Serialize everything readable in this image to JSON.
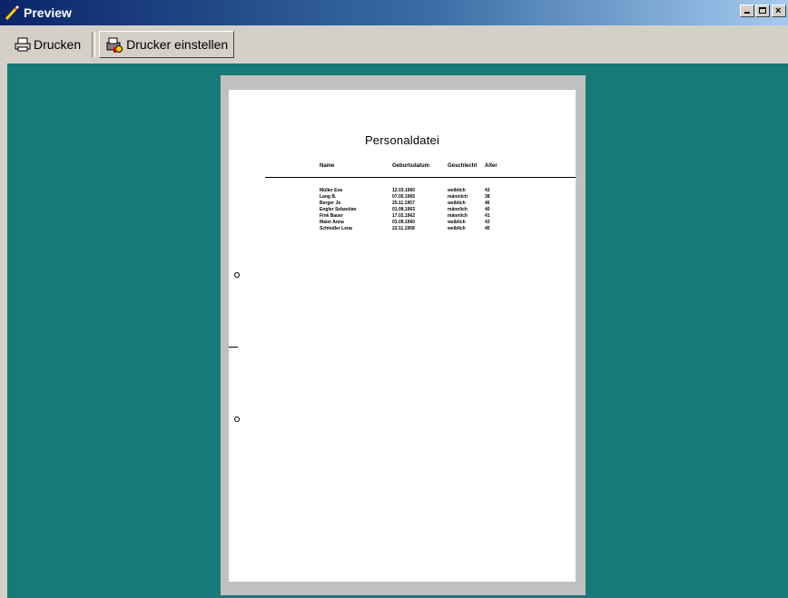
{
  "window": {
    "title": "Preview",
    "app_icon": "wand-icon",
    "controls": [
      "minimize-icon",
      "maximize-icon",
      "close-icon"
    ]
  },
  "toolbar": {
    "print_label": "Drucken",
    "print_icon": "printer-icon",
    "printer_setup_label": "Drucker einstellen",
    "printer_setup_icon": "printer-setup-icon"
  },
  "colors": {
    "workspace": "#177a78",
    "title_bar_start": "#0a246a",
    "title_bar_end": "#a6caf0"
  },
  "document": {
    "title": "Personaldatei",
    "columns": [
      "Name",
      "Geburtsdatum",
      "Geschlecht",
      "Alter"
    ],
    "rows": [
      [
        "Müller Eva",
        "12.03.1960",
        "weiblich",
        "43"
      ],
      [
        "Lang B.",
        "07.05.1965",
        "männlich",
        "38"
      ],
      [
        "Berger Jo",
        "25.11.1957",
        "weiblich",
        "46"
      ],
      [
        "Engler Sebastian",
        "01.08.1963",
        "männlich",
        "40"
      ],
      [
        "Fink Bauer",
        "17.02.1962",
        "männlich",
        "41"
      ],
      [
        "Maier Anna",
        "03.09.1960",
        "weiblich",
        "43"
      ],
      [
        "Schindler Lena",
        "22.11.1958",
        "weiblich",
        "45"
      ]
    ]
  }
}
